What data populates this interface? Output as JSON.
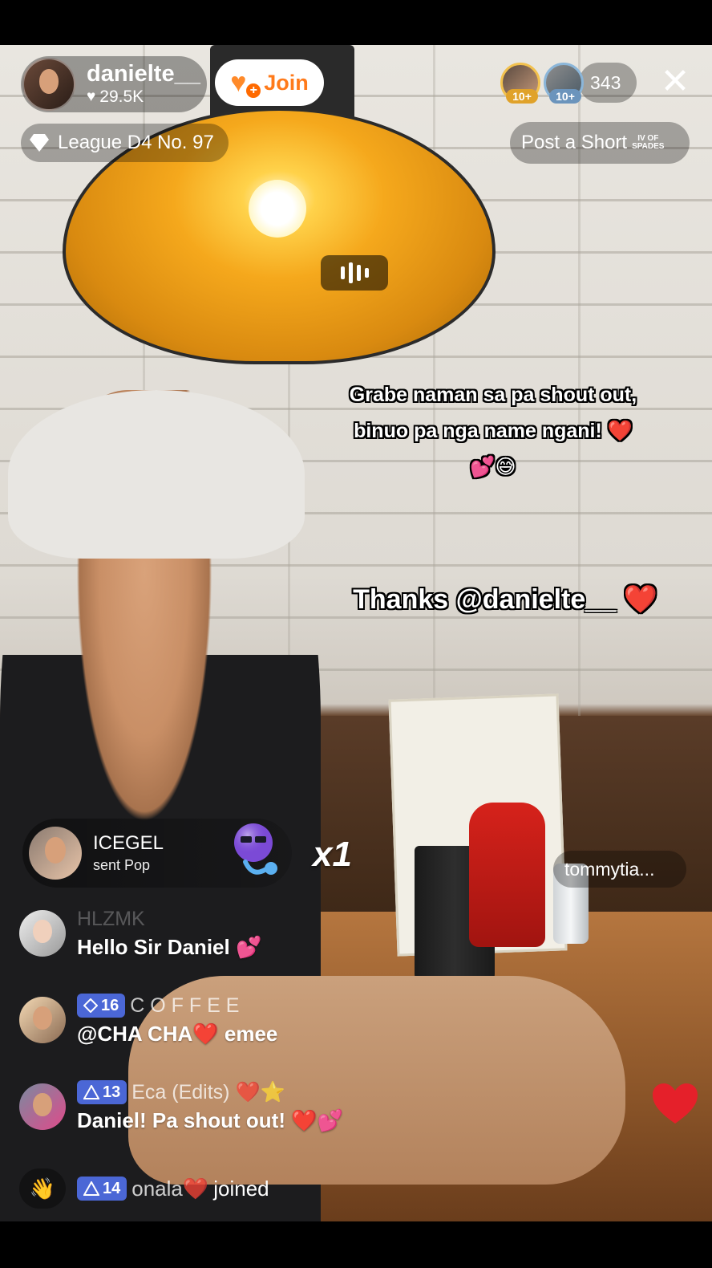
{
  "host": {
    "username": "danielte__",
    "likes": "29.5K",
    "join_label": "Join",
    "league": "League D4 No. 97"
  },
  "viewers": {
    "top_viewers": [
      {
        "badge": "10+"
      },
      {
        "badge": "10+"
      }
    ],
    "count": "343"
  },
  "post_short": {
    "label": "Post a Short",
    "logo_line1": "IV OF",
    "logo_line2": "SPADES"
  },
  "captions": {
    "caption1": "Grabe naman sa pa shout out, binuo pa nga name ngani! ❤️💕😅",
    "caption2": "Thanks @danielte__ ❤️"
  },
  "gift": {
    "sender": "ICEGEL",
    "action": "sent Pop",
    "count": "x1"
  },
  "tommy_pill": "tommytia...",
  "chat": [
    {
      "user": "HLZMK",
      "level": "",
      "message": "Hello Sir Daniel 💕"
    },
    {
      "user": "C O F F E E",
      "level": "16",
      "message": "@CHA CHA❤️ emee"
    },
    {
      "user": "Eca (Edits) ❤️⭐",
      "level": "13",
      "message": "Daniel! Pa shout out! ❤️💕"
    }
  ],
  "joined": {
    "level": "14",
    "user": "onala❤️",
    "action": "joined"
  },
  "colors": {
    "join_orange": "#ff7a1a",
    "level_badge": "#4b67d6",
    "heart_red": "#e5202a"
  },
  "icons": [
    "heart-icon",
    "join-heart-icon",
    "close-icon",
    "diamond-icon",
    "audio-wave-icon",
    "pop-gift-icon",
    "wave-hand-icon",
    "level-diamond-icon"
  ]
}
